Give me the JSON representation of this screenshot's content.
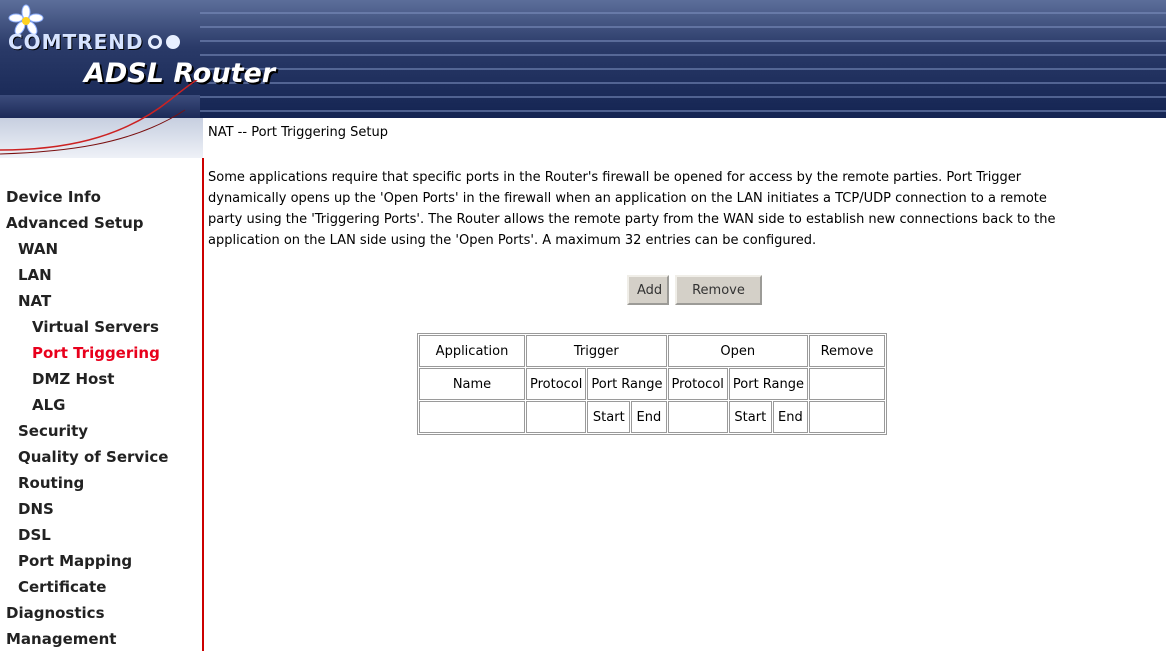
{
  "header": {
    "brand": "COMTREND",
    "product": "ADSL Router",
    "logo_icon": "flower-logo-icon",
    "colors": {
      "banner": "#1c2a58",
      "accent_red": "#e8001c"
    }
  },
  "sidebar": {
    "items": [
      {
        "label": "Device Info",
        "level": 0,
        "active": false
      },
      {
        "label": "Advanced Setup",
        "level": 0,
        "active": false
      },
      {
        "label": "WAN",
        "level": 1,
        "active": false
      },
      {
        "label": "LAN",
        "level": 1,
        "active": false
      },
      {
        "label": "NAT",
        "level": 1,
        "active": false
      },
      {
        "label": "Virtual Servers",
        "level": 2,
        "active": false
      },
      {
        "label": "Port Triggering",
        "level": 2,
        "active": true
      },
      {
        "label": "DMZ Host",
        "level": 2,
        "active": false
      },
      {
        "label": "ALG",
        "level": 2,
        "active": false
      },
      {
        "label": "Security",
        "level": 1,
        "active": false
      },
      {
        "label": "Quality of Service",
        "level": 1,
        "active": false
      },
      {
        "label": "Routing",
        "level": 1,
        "active": false
      },
      {
        "label": "DNS",
        "level": 1,
        "active": false
      },
      {
        "label": "DSL",
        "level": 1,
        "active": false
      },
      {
        "label": "Port Mapping",
        "level": 1,
        "active": false
      },
      {
        "label": "Certificate",
        "level": 1,
        "active": false
      },
      {
        "label": "Diagnostics",
        "level": 0,
        "active": false
      },
      {
        "label": "Management",
        "level": 0,
        "active": false
      }
    ]
  },
  "main": {
    "title": "NAT -- Port Triggering Setup",
    "intro_lines": [
      "Some applications require that specific ports in the Router's firewall be opened for access by the remote parties. Port Trigger",
      "dynamically opens up the 'Open Ports' in the firewall when an application on the LAN initiates a TCP/UDP connection to a remote",
      "party using the 'Triggering Ports'. The Router allows the remote party from the WAN side to establish new connections back to the",
      "application on the LAN side using the 'Open Ports'. A maximum 32 entries can be configured."
    ],
    "buttons": {
      "add": "Add",
      "remove": "Remove"
    },
    "table": {
      "row1": {
        "application": "Application",
        "trigger": "Trigger",
        "open": "Open",
        "remove": "Remove"
      },
      "row2": {
        "name": "Name",
        "protocol": "Protocol",
        "port_range": "Port Range",
        "protocol2": "Protocol",
        "port_range2": "Port Range"
      },
      "row3": {
        "start": "Start",
        "end": "End",
        "start2": "Start",
        "end2": "End"
      }
    }
  }
}
